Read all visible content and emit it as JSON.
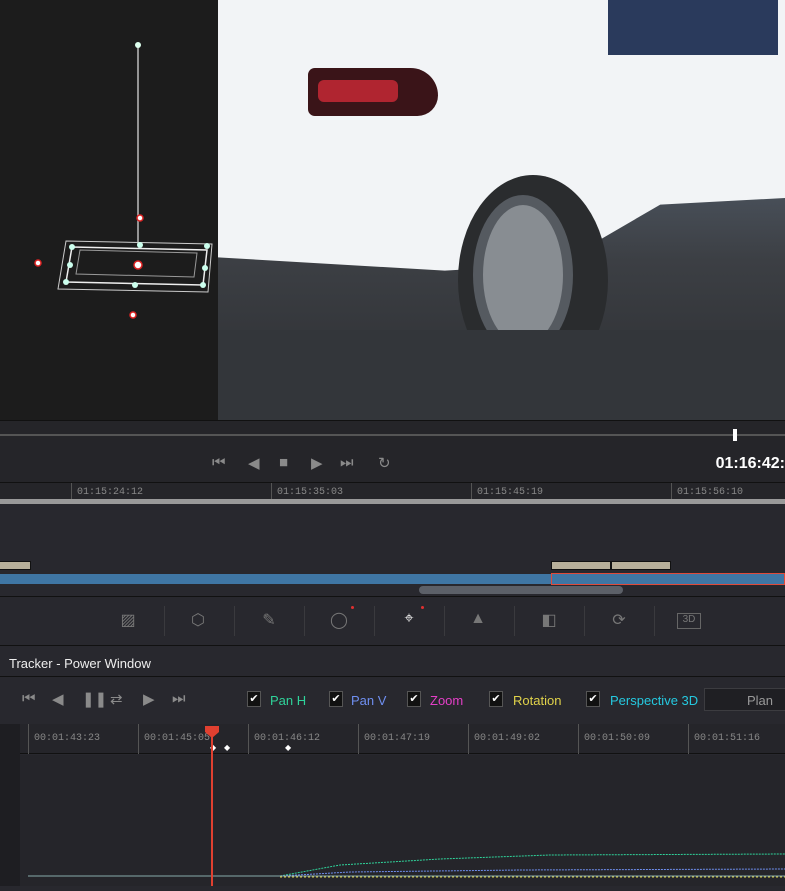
{
  "viewer": {
    "timecode": "01:16:42:"
  },
  "transport": {
    "icons": [
      "skip-to-start-icon",
      "step-back-icon",
      "stop-icon",
      "play-icon",
      "skip-to-end-icon",
      "loop-icon"
    ]
  },
  "timeline": {
    "ticks": [
      "01:15:24:12",
      "01:15:35:03",
      "01:15:45:19",
      "01:15:56:10"
    ]
  },
  "palette_tools": [
    "curves-icon",
    "color-warper-icon",
    "qualifier-icon",
    "window-icon",
    "tracker-icon",
    "blur-icon",
    "key-icon",
    "sizing-icon",
    "3d-icon"
  ],
  "tracker": {
    "title": "Tracker -  Power Window",
    "options": [
      {
        "label": "Pan H",
        "checked": true,
        "color": "#2fd39a"
      },
      {
        "label": "Pan V",
        "checked": true,
        "color": "#6f8ff0"
      },
      {
        "label": "Zoom",
        "checked": true,
        "color": "#e53fc8"
      },
      {
        "label": "Rotation",
        "checked": true,
        "color": "#e0d24a"
      },
      {
        "label": "Perspective 3D",
        "checked": true,
        "color": "#25c9e0"
      }
    ],
    "mode": "Plan",
    "ticks": [
      "00:01:43:23",
      "00:01:45:05",
      "00:01:46:12",
      "00:01:47:19",
      "00:01:49:02",
      "00:01:50:09",
      "00:01:51:16"
    ],
    "playhead_color": "#e04030"
  }
}
